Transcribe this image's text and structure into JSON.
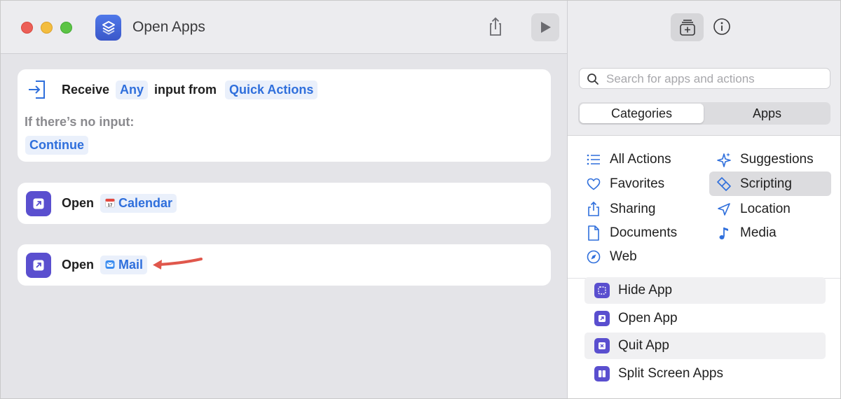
{
  "window": {
    "title": "Open Apps"
  },
  "receive_card": {
    "receive_label": "Receive",
    "input_type": "Any",
    "input_from_label": "input from",
    "source": "Quick Actions",
    "no_input_label": "If there’s no input:",
    "no_input_action": "Continue"
  },
  "actions": [
    {
      "verb": "Open",
      "app": "Calendar",
      "app_icon": "calendar-icon"
    },
    {
      "verb": "Open",
      "app": "Mail",
      "app_icon": "mail-icon"
    }
  ],
  "sidebar": {
    "search_placeholder": "Search for apps and actions",
    "tabs": [
      "Categories",
      "Apps"
    ],
    "active_tab": "Categories",
    "categories": [
      {
        "label": "All Actions",
        "icon": "list-icon"
      },
      {
        "label": "Suggestions",
        "icon": "sparkles-icon"
      },
      {
        "label": "Favorites",
        "icon": "heart-icon"
      },
      {
        "label": "Scripting",
        "icon": "scripting-icon",
        "selected": true
      },
      {
        "label": "Sharing",
        "icon": "share-icon"
      },
      {
        "label": "Location",
        "icon": "location-arrow-icon"
      },
      {
        "label": "Documents",
        "icon": "document-icon"
      },
      {
        "label": "Media",
        "icon": "music-note-icon"
      },
      {
        "label": "Web",
        "icon": "compass-icon"
      }
    ],
    "results": [
      {
        "label": "Hide App",
        "icon": "hide-app-icon"
      },
      {
        "label": "Open App",
        "icon": "open-app-icon"
      },
      {
        "label": "Quit App",
        "icon": "quit-app-icon"
      },
      {
        "label": "Split Screen Apps",
        "icon": "split-screen-icon"
      }
    ]
  },
  "colors": {
    "accent": "#2f6fdc",
    "action_purple": "#5a4fcf",
    "annotation_arrow": "#e0574c"
  }
}
